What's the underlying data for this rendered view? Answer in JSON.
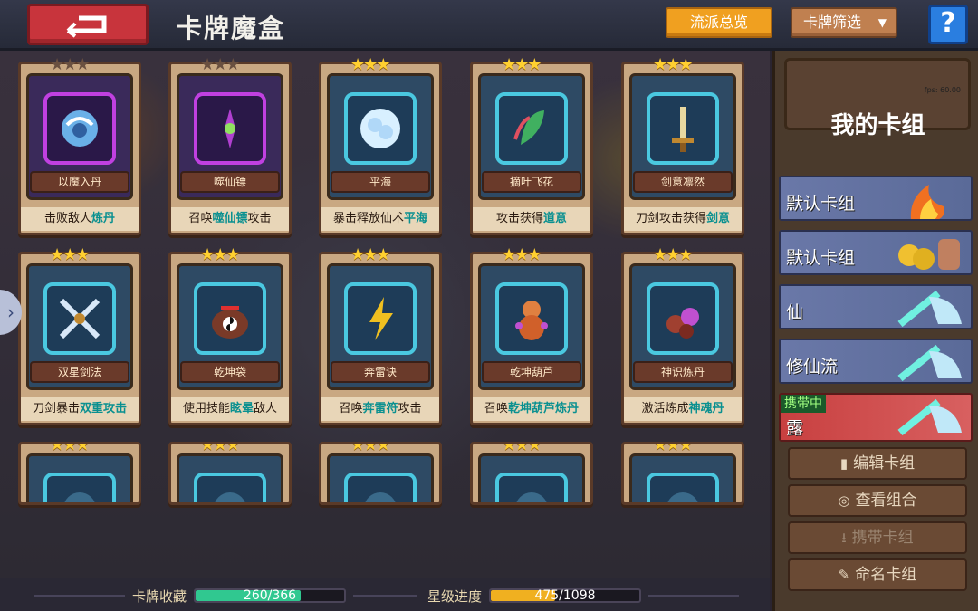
{
  "header": {
    "title": "卡牌魔盒",
    "overview_label": "流派总览",
    "filter_label": "卡牌筛选",
    "help_label": "?"
  },
  "cards": [
    {
      "name": "以魔入丹",
      "desc_pre": "击败敌人",
      "desc_hl": "炼丹",
      "desc_post": "",
      "stars": "★★★",
      "rarity": "purple",
      "icon": "sphere-icon",
      "stars_dark": true
    },
    {
      "name": "噬仙镖",
      "desc_pre": "召唤",
      "desc_hl": "噬仙镖",
      "desc_post": "攻击",
      "stars": "★★★",
      "rarity": "purple",
      "icon": "dart-icon",
      "stars_dark": true
    },
    {
      "name": "平海",
      "desc_pre": "暴击释放仙术",
      "desc_hl": "平海",
      "desc_post": "",
      "stars": "★★★",
      "rarity": "blue",
      "icon": "wave-icon"
    },
    {
      "name": "摘叶飞花",
      "desc_pre": "攻击获得",
      "desc_hl": "道意",
      "desc_post": "",
      "stars": "★★★",
      "rarity": "blue",
      "icon": "leaf-icon"
    },
    {
      "name": "剑意凛然",
      "desc_pre": "刀剑攻击获得",
      "desc_hl": "剑意",
      "desc_post": "",
      "stars": "★★★",
      "rarity": "blue",
      "icon": "sword-icon"
    },
    {
      "name": "双星剑法",
      "desc_pre": "刀剑暴击",
      "desc_hl": "双重攻击",
      "desc_post": "",
      "stars": "★★★",
      "rarity": "blue",
      "icon": "crossed-swords-icon"
    },
    {
      "name": "乾坤袋",
      "desc_pre": "使用技能",
      "desc_hl": "眩晕",
      "desc_post": "敌人",
      "stars": "★★★",
      "rarity": "blue",
      "icon": "bag-icon"
    },
    {
      "name": "奔雷诀",
      "desc_pre": "召唤",
      "desc_hl": "奔雷符",
      "desc_post": "攻击",
      "stars": "★★★",
      "rarity": "blue",
      "icon": "lightning-icon"
    },
    {
      "name": "乾坤葫芦",
      "desc_pre": "召唤",
      "desc_hl": "乾坤葫芦炼丹",
      "desc_post": "",
      "stars": "★★★",
      "rarity": "blue",
      "icon": "gourd-icon"
    },
    {
      "name": "神识炼丹",
      "desc_pre": "激活炼成",
      "desc_hl": "神魂丹",
      "desc_post": "",
      "stars": "★★★",
      "rarity": "blue",
      "icon": "pills-icon"
    },
    {
      "name": "",
      "desc_pre": "",
      "desc_hl": "",
      "desc_post": "",
      "stars": "★★★",
      "rarity": "blue",
      "icon": "unknown-icon"
    },
    {
      "name": "",
      "desc_pre": "",
      "desc_hl": "",
      "desc_post": "",
      "stars": "★★★",
      "rarity": "blue",
      "icon": "unknown-icon"
    },
    {
      "name": "",
      "desc_pre": "",
      "desc_hl": "",
      "desc_post": "",
      "stars": "★★★",
      "rarity": "blue",
      "icon": "unknown-icon"
    },
    {
      "name": "",
      "desc_pre": "",
      "desc_hl": "",
      "desc_post": "",
      "stars": "★★★",
      "rarity": "blue",
      "icon": "unknown-icon"
    },
    {
      "name": "",
      "desc_pre": "",
      "desc_hl": "",
      "desc_post": "",
      "stars": "★★★",
      "rarity": "blue",
      "icon": "unknown-icon"
    }
  ],
  "progress": {
    "collection_label": "卡牌收藏",
    "collection_value": "260/366",
    "collection_fraction": 0.71,
    "star_label": "星级进度",
    "star_value": "475/1098",
    "star_fraction": 0.43
  },
  "deck_panel": {
    "title": "我的卡组",
    "fps": "fps: 60.00",
    "decks": [
      {
        "label": "默认卡组",
        "thumb": "fire-icon",
        "active": false
      },
      {
        "label": "默认卡组",
        "thumb": "coins-icon",
        "active": false
      },
      {
        "label": "仙",
        "thumb": "sword-wing-icon",
        "active": false
      },
      {
        "label": "修仙流",
        "thumb": "sword-wing-icon",
        "active": false
      },
      {
        "label": "露",
        "thumb": "sword-wing-icon",
        "active": true,
        "badge": "携带中"
      }
    ],
    "actions": [
      {
        "label": "编辑卡组",
        "icon": "copy-icon",
        "glyph": "▮",
        "disabled": false
      },
      {
        "label": "查看组合",
        "icon": "eye-icon",
        "glyph": "◎",
        "disabled": false
      },
      {
        "label": "携带卡组",
        "icon": "download-icon",
        "glyph": "⭳",
        "disabled": true
      },
      {
        "label": "命名卡组",
        "icon": "pencil-icon",
        "glyph": "✎",
        "disabled": false
      }
    ]
  }
}
